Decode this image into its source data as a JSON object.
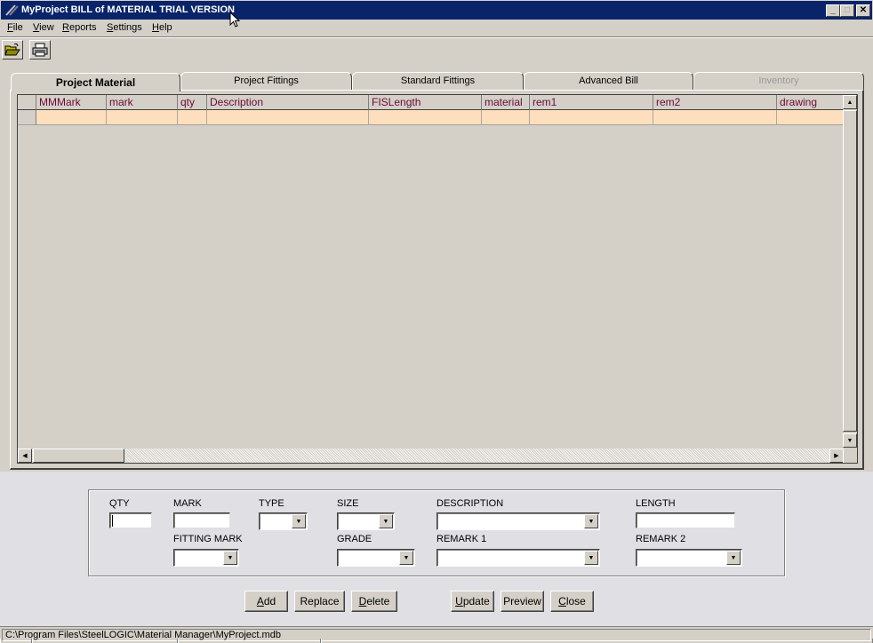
{
  "window": {
    "title": "MyProject BILL of MATERIAL  TRIAL VERSION",
    "minimize_glyph": "_",
    "maximize_glyph": "□",
    "close_glyph": "✕"
  },
  "menu": [
    {
      "accel": "F",
      "rest": "ile"
    },
    {
      "accel": "V",
      "rest": "iew"
    },
    {
      "accel": "R",
      "rest": "eports"
    },
    {
      "accel": "S",
      "rest": "ettings"
    },
    {
      "accel": "H",
      "rest": "elp"
    }
  ],
  "toolbar": {
    "open_icon": "open-folder-icon",
    "print_icon": "printer-icon"
  },
  "tabs": [
    {
      "label": "Project Material",
      "active": true,
      "enabled": true
    },
    {
      "label": "Project Fittings",
      "active": false,
      "enabled": true
    },
    {
      "label": "Standard Fittings",
      "active": false,
      "enabled": true
    },
    {
      "label": "Advanced Bill",
      "active": false,
      "enabled": true
    },
    {
      "label": "Inventory",
      "active": false,
      "enabled": false
    }
  ],
  "grid": {
    "columns": [
      "MMMark",
      "mark",
      "qty",
      "Description",
      "FISLength",
      "material",
      "rem1",
      "rem2",
      "drawing"
    ],
    "rows": [
      [
        "",
        "",
        "",
        "",
        "",
        "",
        "",
        "",
        ""
      ]
    ],
    "new_row_color": "#fddfbd",
    "header_text_color": "#6b0a3a"
  },
  "form": {
    "qty": {
      "label": "QTY",
      "value": ""
    },
    "mark": {
      "label": "MARK",
      "value": ""
    },
    "type": {
      "label": "TYPE",
      "value": ""
    },
    "size": {
      "label": "SIZE",
      "value": ""
    },
    "description": {
      "label": "DESCRIPTION",
      "value": ""
    },
    "length": {
      "label": "LENGTH",
      "value": ""
    },
    "fitting_mark": {
      "label": "FITTING MARK",
      "value": ""
    },
    "grade": {
      "label": "GRADE",
      "value": ""
    },
    "remark1": {
      "label": "REMARK 1",
      "value": ""
    },
    "remark2": {
      "label": "REMARK 2",
      "value": ""
    }
  },
  "buttons": {
    "add": {
      "accel": "A",
      "rest": "dd"
    },
    "replace": {
      "accel": "",
      "rest": "Replace"
    },
    "delete": {
      "accel": "D",
      "rest": "elete"
    },
    "update": {
      "accel": "U",
      "rest": "pdate"
    },
    "preview": {
      "accel": "",
      "rest": "Preview"
    },
    "close": {
      "accel": "C",
      "rest": "lose"
    }
  },
  "status": {
    "path": "C:\\Program Files\\SteelLOGIC\\Material Manager\\MyProject.mdb"
  }
}
